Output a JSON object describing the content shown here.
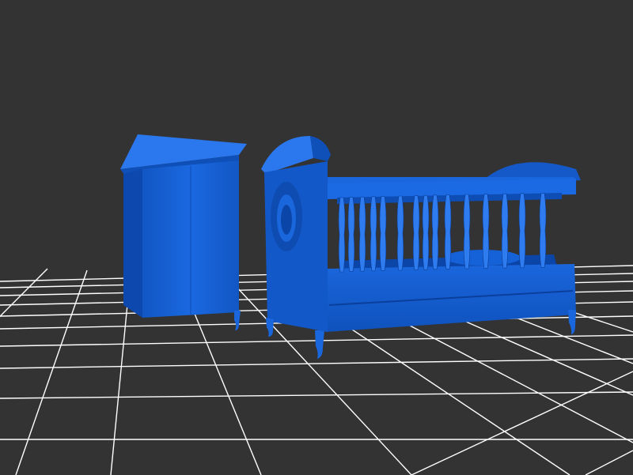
{
  "scene": {
    "background_color": "#333333",
    "grid_color": "#ffffff",
    "model_color": "#1560d6",
    "model_shadow_color": "#0a3f99",
    "model_highlight_color": "#2f7bf0",
    "objects": [
      "wardrobe",
      "crib"
    ]
  }
}
